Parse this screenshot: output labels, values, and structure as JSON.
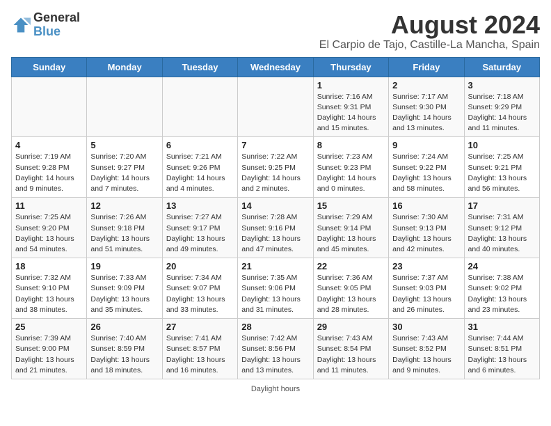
{
  "header": {
    "logo_general": "General",
    "logo_blue": "Blue",
    "title": "August 2024",
    "subtitle": "El Carpio de Tajo, Castille-La Mancha, Spain"
  },
  "columns": [
    "Sunday",
    "Monday",
    "Tuesday",
    "Wednesday",
    "Thursday",
    "Friday",
    "Saturday"
  ],
  "weeks": [
    [
      {
        "day": "",
        "info": ""
      },
      {
        "day": "",
        "info": ""
      },
      {
        "day": "",
        "info": ""
      },
      {
        "day": "",
        "info": ""
      },
      {
        "day": "1",
        "info": "Sunrise: 7:16 AM\nSunset: 9:31 PM\nDaylight: 14 hours\nand 15 minutes."
      },
      {
        "day": "2",
        "info": "Sunrise: 7:17 AM\nSunset: 9:30 PM\nDaylight: 14 hours\nand 13 minutes."
      },
      {
        "day": "3",
        "info": "Sunrise: 7:18 AM\nSunset: 9:29 PM\nDaylight: 14 hours\nand 11 minutes."
      }
    ],
    [
      {
        "day": "4",
        "info": "Sunrise: 7:19 AM\nSunset: 9:28 PM\nDaylight: 14 hours\nand 9 minutes."
      },
      {
        "day": "5",
        "info": "Sunrise: 7:20 AM\nSunset: 9:27 PM\nDaylight: 14 hours\nand 7 minutes."
      },
      {
        "day": "6",
        "info": "Sunrise: 7:21 AM\nSunset: 9:26 PM\nDaylight: 14 hours\nand 4 minutes."
      },
      {
        "day": "7",
        "info": "Sunrise: 7:22 AM\nSunset: 9:25 PM\nDaylight: 14 hours\nand 2 minutes."
      },
      {
        "day": "8",
        "info": "Sunrise: 7:23 AM\nSunset: 9:23 PM\nDaylight: 14 hours\nand 0 minutes."
      },
      {
        "day": "9",
        "info": "Sunrise: 7:24 AM\nSunset: 9:22 PM\nDaylight: 13 hours\nand 58 minutes."
      },
      {
        "day": "10",
        "info": "Sunrise: 7:25 AM\nSunset: 9:21 PM\nDaylight: 13 hours\nand 56 minutes."
      }
    ],
    [
      {
        "day": "11",
        "info": "Sunrise: 7:25 AM\nSunset: 9:20 PM\nDaylight: 13 hours\nand 54 minutes."
      },
      {
        "day": "12",
        "info": "Sunrise: 7:26 AM\nSunset: 9:18 PM\nDaylight: 13 hours\nand 51 minutes."
      },
      {
        "day": "13",
        "info": "Sunrise: 7:27 AM\nSunset: 9:17 PM\nDaylight: 13 hours\nand 49 minutes."
      },
      {
        "day": "14",
        "info": "Sunrise: 7:28 AM\nSunset: 9:16 PM\nDaylight: 13 hours\nand 47 minutes."
      },
      {
        "day": "15",
        "info": "Sunrise: 7:29 AM\nSunset: 9:14 PM\nDaylight: 13 hours\nand 45 minutes."
      },
      {
        "day": "16",
        "info": "Sunrise: 7:30 AM\nSunset: 9:13 PM\nDaylight: 13 hours\nand 42 minutes."
      },
      {
        "day": "17",
        "info": "Sunrise: 7:31 AM\nSunset: 9:12 PM\nDaylight: 13 hours\nand 40 minutes."
      }
    ],
    [
      {
        "day": "18",
        "info": "Sunrise: 7:32 AM\nSunset: 9:10 PM\nDaylight: 13 hours\nand 38 minutes."
      },
      {
        "day": "19",
        "info": "Sunrise: 7:33 AM\nSunset: 9:09 PM\nDaylight: 13 hours\nand 35 minutes."
      },
      {
        "day": "20",
        "info": "Sunrise: 7:34 AM\nSunset: 9:07 PM\nDaylight: 13 hours\nand 33 minutes."
      },
      {
        "day": "21",
        "info": "Sunrise: 7:35 AM\nSunset: 9:06 PM\nDaylight: 13 hours\nand 31 minutes."
      },
      {
        "day": "22",
        "info": "Sunrise: 7:36 AM\nSunset: 9:05 PM\nDaylight: 13 hours\nand 28 minutes."
      },
      {
        "day": "23",
        "info": "Sunrise: 7:37 AM\nSunset: 9:03 PM\nDaylight: 13 hours\nand 26 minutes."
      },
      {
        "day": "24",
        "info": "Sunrise: 7:38 AM\nSunset: 9:02 PM\nDaylight: 13 hours\nand 23 minutes."
      }
    ],
    [
      {
        "day": "25",
        "info": "Sunrise: 7:39 AM\nSunset: 9:00 PM\nDaylight: 13 hours\nand 21 minutes."
      },
      {
        "day": "26",
        "info": "Sunrise: 7:40 AM\nSunset: 8:59 PM\nDaylight: 13 hours\nand 18 minutes."
      },
      {
        "day": "27",
        "info": "Sunrise: 7:41 AM\nSunset: 8:57 PM\nDaylight: 13 hours\nand 16 minutes."
      },
      {
        "day": "28",
        "info": "Sunrise: 7:42 AM\nSunset: 8:56 PM\nDaylight: 13 hours\nand 13 minutes."
      },
      {
        "day": "29",
        "info": "Sunrise: 7:43 AM\nSunset: 8:54 PM\nDaylight: 13 hours\nand 11 minutes."
      },
      {
        "day": "30",
        "info": "Sunrise: 7:43 AM\nSunset: 8:52 PM\nDaylight: 13 hours\nand 9 minutes."
      },
      {
        "day": "31",
        "info": "Sunrise: 7:44 AM\nSunset: 8:51 PM\nDaylight: 13 hours\nand 6 minutes."
      }
    ]
  ],
  "footer": {
    "daylight_label": "Daylight hours"
  }
}
